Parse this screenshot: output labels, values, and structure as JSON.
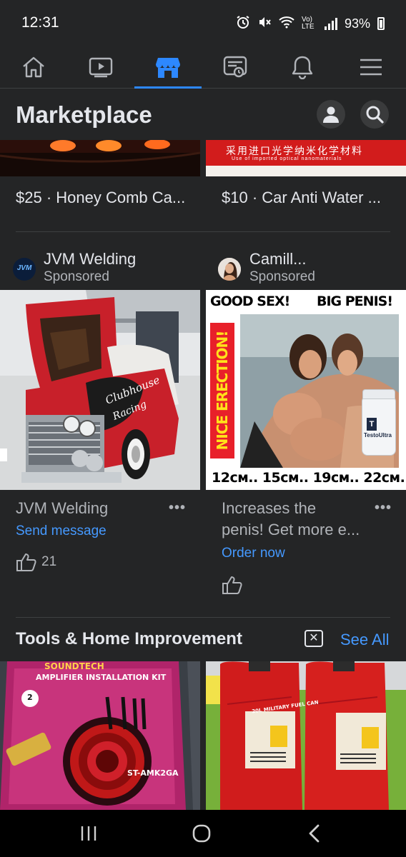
{
  "status_bar": {
    "time": "12:31",
    "network_label": "Vo) LTE",
    "battery": "93%"
  },
  "top_nav": {
    "items": [
      {
        "icon": "home-icon"
      },
      {
        "icon": "video-icon"
      },
      {
        "icon": "marketplace-icon",
        "active": true
      },
      {
        "icon": "news-feed-icon"
      },
      {
        "icon": "bell-icon"
      },
      {
        "icon": "menu-icon"
      }
    ],
    "active_color": "#2d88ff"
  },
  "header": {
    "title": "Marketplace"
  },
  "listings_top": [
    {
      "title": "$25 · Honey Comb Ca..."
    },
    {
      "title": "$10 · Car Anti Water ...",
      "image_text": "采用进口光学纳米化学材料",
      "image_subtext": "Use of imported optical nanomaterials"
    }
  ],
  "ads": [
    {
      "sponsor_name": "JVM Welding",
      "sponsor_label": "Sponsored",
      "avatar_text": "JVM",
      "image_text": "Clubhouse Racing",
      "title": "JVM Welding",
      "action": "Send message",
      "more": "•••",
      "likes": "21"
    },
    {
      "sponsor_name": "Camill...",
      "sponsor_label": "Sponsored",
      "image_headline_left": "GOOD SEX!",
      "image_headline_right": "BIG PENIS!",
      "image_side_text": "NICE ERECTION!",
      "image_bottle_label": "TestoUltra",
      "image_sizes": "12см.. 15см.. 19см.. 22см..",
      "title_line1": "Increases the",
      "title_line2": "penis! Get more e...",
      "action": "Order now",
      "more": "•••"
    }
  ],
  "section": {
    "title": "Tools & Home Improvement",
    "see_all": "See All",
    "close_glyph": "✕"
  },
  "tools_items": [
    {
      "brand": "SOUNDTECH",
      "kit": "AMPLIFIER INSTALLATION KIT",
      "model": "ST-AMK2GA",
      "gauge": "2"
    },
    {
      "label": "20L MILITARY FUEL CAN"
    }
  ],
  "system_nav": {
    "icons": [
      "recents-icon",
      "home-button-icon",
      "back-icon"
    ]
  },
  "colors": {
    "background": "#242526",
    "text_primary": "#e4e6eb",
    "text_secondary": "#b0b3b8",
    "link": "#4599ff",
    "divider": "#3e4042"
  }
}
